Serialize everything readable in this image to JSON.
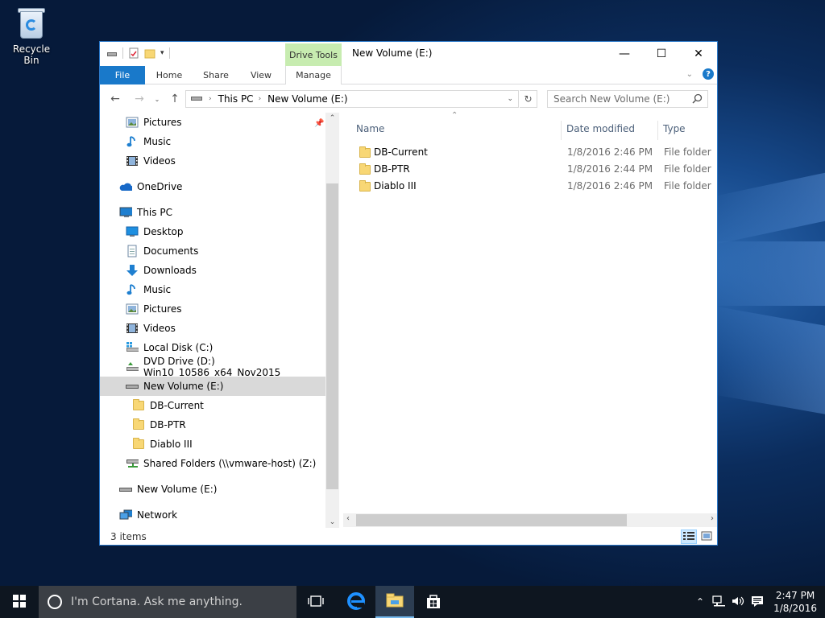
{
  "desktop": {
    "recycle_bin_label": "Recycle Bin"
  },
  "window": {
    "title": "New Volume (E:)",
    "contextual_tab_group": "Drive Tools",
    "caption": {
      "minimize": "—",
      "maximize": "☐",
      "close": "✕"
    },
    "ribbon_tabs": [
      "File",
      "Home",
      "Share",
      "View",
      "Manage"
    ],
    "help_label": "?"
  },
  "address_bar": {
    "segments": [
      "This PC",
      "New Volume (E:)"
    ],
    "search_placeholder": "Search New Volume (E:)"
  },
  "nav_pane": {
    "items": [
      {
        "label": "Pictures",
        "icon": "pictures-icon",
        "indent": 1
      },
      {
        "label": "Music",
        "icon": "music-icon",
        "indent": 1
      },
      {
        "label": "Videos",
        "icon": "videos-icon",
        "indent": 1
      },
      {
        "label": "OneDrive",
        "icon": "onedrive-icon",
        "indent": 0
      },
      {
        "label": "This PC",
        "icon": "this-pc-icon",
        "indent": 0
      },
      {
        "label": "Desktop",
        "icon": "desktop-icon",
        "indent": 1
      },
      {
        "label": "Documents",
        "icon": "documents-icon",
        "indent": 1
      },
      {
        "label": "Downloads",
        "icon": "downloads-icon",
        "indent": 1
      },
      {
        "label": "Music",
        "icon": "music-icon",
        "indent": 1
      },
      {
        "label": "Pictures",
        "icon": "pictures-icon",
        "indent": 1
      },
      {
        "label": "Videos",
        "icon": "videos-icon",
        "indent": 1
      },
      {
        "label": "Local Disk (C:)",
        "icon": "local-disk-icon",
        "indent": 1
      },
      {
        "label": "DVD Drive (D:) Win10_10586_x64_Nov2015",
        "icon": "dvd-drive-icon",
        "indent": 1
      },
      {
        "label": "New Volume (E:)",
        "icon": "drive-icon",
        "indent": 1,
        "selected": true
      },
      {
        "label": "DB-Current",
        "icon": "folder-icon",
        "indent": 2
      },
      {
        "label": "DB-PTR",
        "icon": "folder-icon",
        "indent": 2
      },
      {
        "label": "Diablo III",
        "icon": "folder-icon",
        "indent": 2
      },
      {
        "label": "Shared Folders (\\\\vmware-host) (Z:)",
        "icon": "network-drive-icon",
        "indent": 1
      },
      {
        "label": "New Volume (E:)",
        "icon": "drive-icon",
        "indent": 0
      },
      {
        "label": "Network",
        "icon": "network-icon",
        "indent": 0
      }
    ]
  },
  "file_list": {
    "columns": {
      "name": "Name",
      "date": "Date modified",
      "type": "Type"
    },
    "rows": [
      {
        "name": "DB-Current",
        "date": "1/8/2016 2:46 PM",
        "type": "File folder"
      },
      {
        "name": "DB-PTR",
        "date": "1/8/2016 2:44 PM",
        "type": "File folder"
      },
      {
        "name": "Diablo III",
        "date": "1/8/2016 2:46 PM",
        "type": "File folder"
      }
    ]
  },
  "status": {
    "item_count": "3 items"
  },
  "taskbar": {
    "cortana_placeholder": "I'm Cortana. Ask me anything.",
    "time": "2:47 PM",
    "date": "1/8/2016"
  },
  "colors": {
    "accent": "#1979ca",
    "drive_tools": "#c7ecb0",
    "selection": "#d9d9d9"
  }
}
